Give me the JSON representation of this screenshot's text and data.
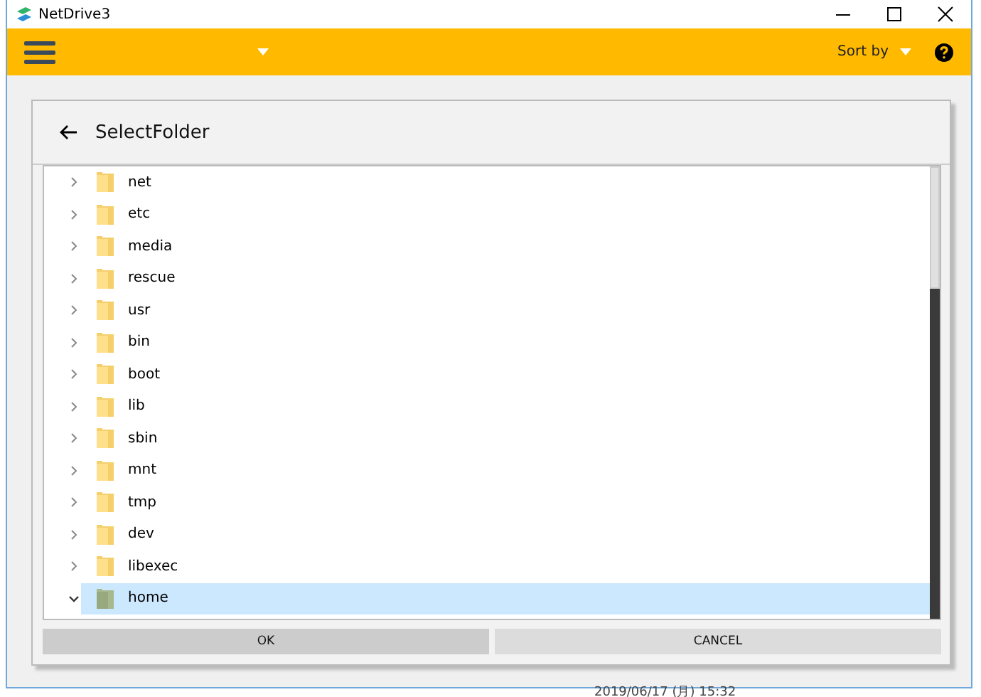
{
  "window": {
    "title": "NetDrive3"
  },
  "toolbar": {
    "sort_label": "Sort by"
  },
  "dialog": {
    "title": "SelectFolder",
    "folders": [
      {
        "name": "net",
        "expanded": false,
        "selected": false
      },
      {
        "name": "etc",
        "expanded": false,
        "selected": false
      },
      {
        "name": "media",
        "expanded": false,
        "selected": false
      },
      {
        "name": "rescue",
        "expanded": false,
        "selected": false
      },
      {
        "name": "usr",
        "expanded": false,
        "selected": false
      },
      {
        "name": "bin",
        "expanded": false,
        "selected": false
      },
      {
        "name": "boot",
        "expanded": false,
        "selected": false
      },
      {
        "name": "lib",
        "expanded": false,
        "selected": false
      },
      {
        "name": "sbin",
        "expanded": false,
        "selected": false
      },
      {
        "name": "mnt",
        "expanded": false,
        "selected": false
      },
      {
        "name": "tmp",
        "expanded": false,
        "selected": false
      },
      {
        "name": "dev",
        "expanded": false,
        "selected": false
      },
      {
        "name": "libexec",
        "expanded": false,
        "selected": false
      },
      {
        "name": "home",
        "expanded": true,
        "selected": true
      }
    ],
    "buttons": [
      {
        "label": "OK",
        "kind": "primary"
      },
      {
        "label": "CANCEL",
        "kind": "secondary"
      }
    ]
  },
  "taskbar_clock": "2019/06/17 (月) 15:32"
}
